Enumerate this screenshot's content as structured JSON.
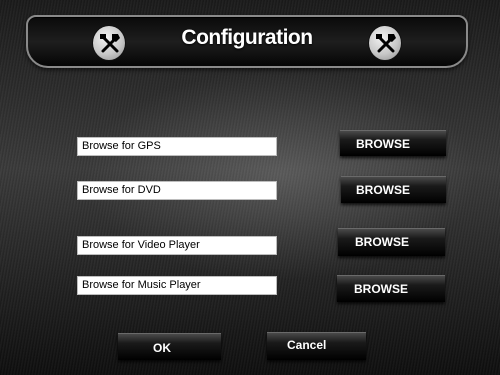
{
  "header": {
    "title": "Configuration",
    "left_icon": "tools-icon",
    "right_icon": "tools-icon"
  },
  "rows": [
    {
      "field_value": "Browse for GPS",
      "button_label": "BROWSE"
    },
    {
      "field_value": "Browse for DVD",
      "button_label": "BROWSE"
    },
    {
      "field_value": "Browse for Video Player",
      "button_label": "BROWSE"
    },
    {
      "field_value": "Browse for Music Player",
      "button_label": "BROWSE"
    }
  ],
  "footer": {
    "ok_label": "OK",
    "cancel_label": "Cancel"
  },
  "colors": {
    "field_background": "#ffffff",
    "button_text": "#ffffff",
    "title_text": "#ffffff"
  }
}
